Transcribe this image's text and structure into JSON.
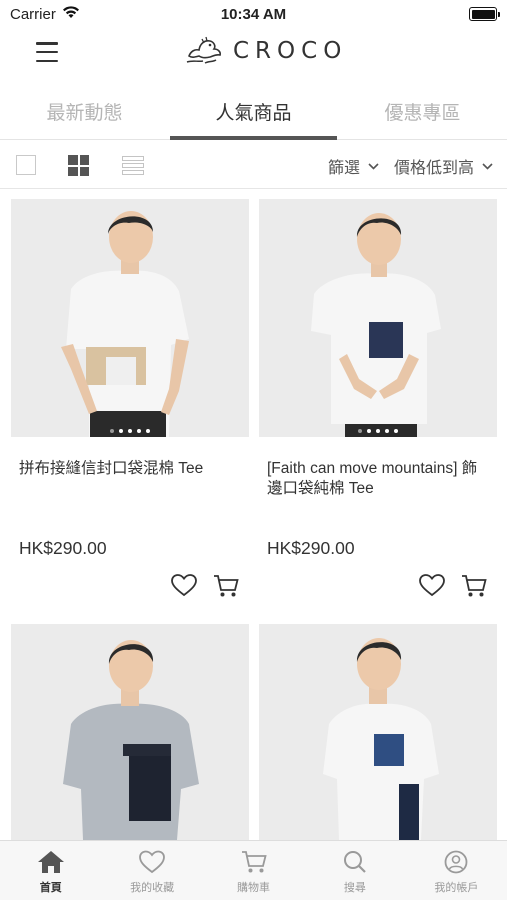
{
  "status_bar": {
    "carrier": "Carrier",
    "time": "10:34 AM"
  },
  "header": {
    "brand": "CROCO"
  },
  "tabs": [
    {
      "label": "最新動態",
      "active": false
    },
    {
      "label": "人氣商品",
      "active": true
    },
    {
      "label": "優惠專區",
      "active": false
    }
  ],
  "toolbar": {
    "filter_label": "篩選",
    "sort_label": "價格低到高"
  },
  "products": [
    {
      "title": "拼布接縫信封口袋混棉 Tee",
      "price": "HK$290.00"
    },
    {
      "title": "[Faith can move mountains] 飾邊口袋純棉 Tee",
      "price": "HK$290.00"
    },
    {
      "title": "",
      "price": ""
    },
    {
      "title": "",
      "price": ""
    }
  ],
  "bottom_nav": [
    {
      "label": "首頁",
      "icon": "home-icon",
      "active": true
    },
    {
      "label": "我的收藏",
      "icon": "heart-icon",
      "active": false
    },
    {
      "label": "購物車",
      "icon": "cart-icon",
      "active": false
    },
    {
      "label": "搜尋",
      "icon": "search-icon",
      "active": false
    },
    {
      "label": "我的帳戶",
      "icon": "account-icon",
      "active": false
    }
  ],
  "colors": {
    "accent": "#555555",
    "inactive_tab": "#b5b5b5",
    "nav_inactive": "#9a9a9a"
  }
}
